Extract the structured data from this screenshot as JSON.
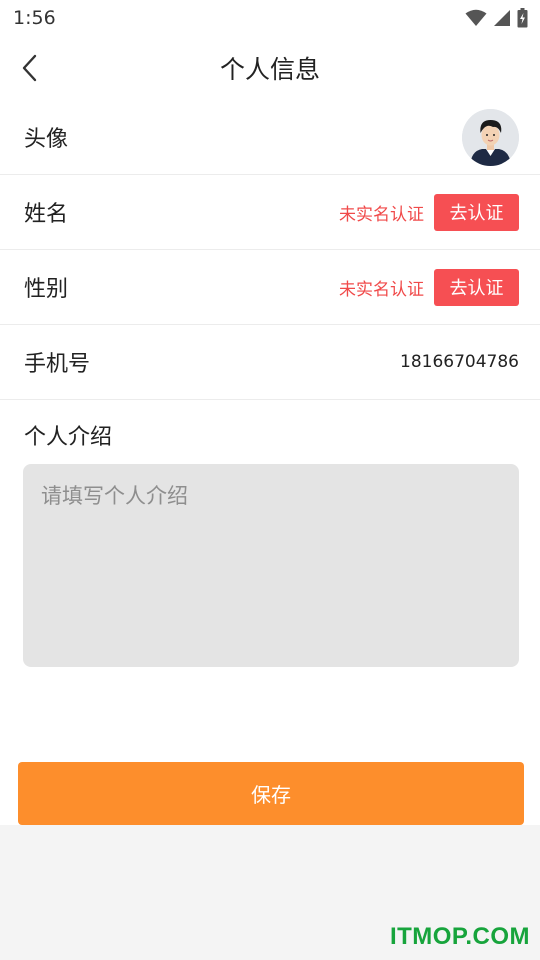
{
  "status_bar": {
    "time": "1:56"
  },
  "header": {
    "title": "个人信息"
  },
  "rows": {
    "avatar": {
      "label": "头像"
    },
    "name": {
      "label": "姓名",
      "status": "未实名认证",
      "button": "去认证"
    },
    "gender": {
      "label": "性别",
      "status": "未实名认证",
      "button": "去认证"
    },
    "phone": {
      "label": "手机号",
      "value": "18166704786"
    }
  },
  "intro": {
    "label": "个人介绍",
    "placeholder": "请填写个人介绍"
  },
  "save_button": "保存",
  "watermark": "ITMOP.COM",
  "colors": {
    "accent": "#fd8e2c",
    "verify_button": "#f64f53",
    "warning_text": "#f04a4a",
    "watermark": "#17a43c"
  }
}
